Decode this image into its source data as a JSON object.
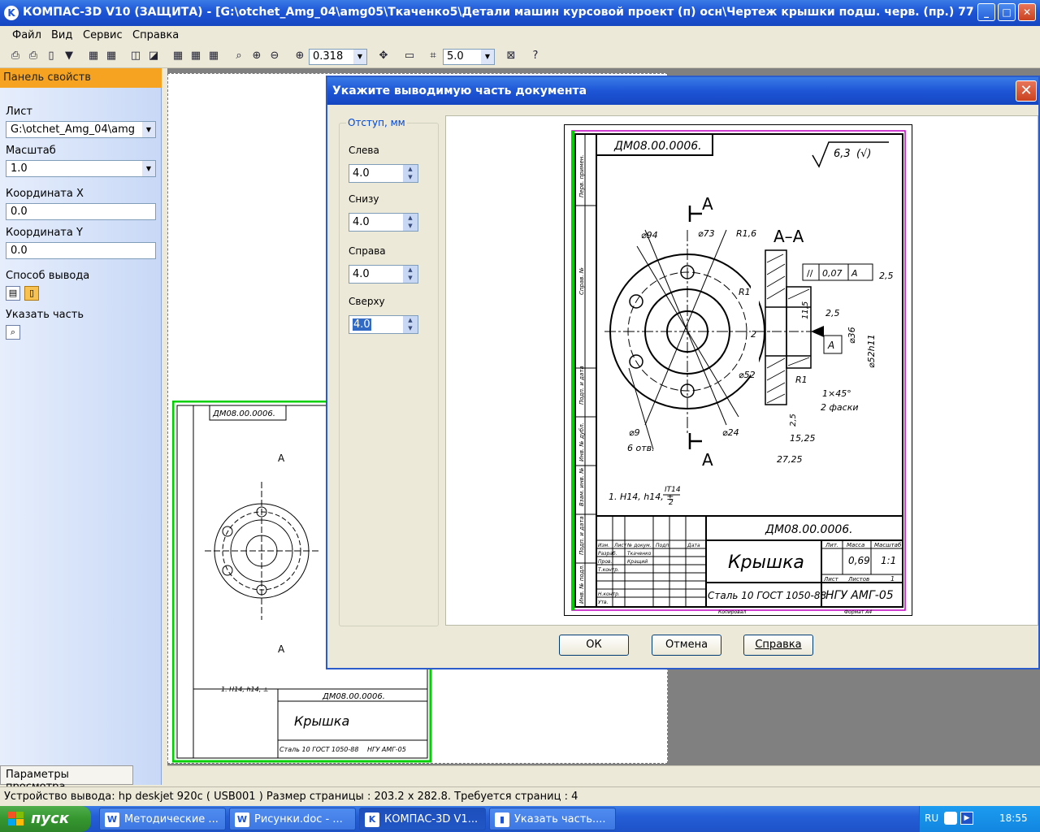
{
  "window": {
    "title": "КОМПАС-3D V10 (ЗАЩИТА) - [G:\\otchet_Amg_04\\amg05\\Ткаченко5\\Детали машин курсовой проект (п) осн\\Чертеж крышки подш. черв. (пр.) 777 ...",
    "minimize": "_",
    "maximize": "□",
    "close": "✕"
  },
  "menu": [
    "Файл",
    "Вид",
    "Сервис",
    "Справка"
  ],
  "toolbar": {
    "zoom": "0.318",
    "step": "5.0"
  },
  "panel": {
    "title": "Панель свойств",
    "sheet_label": "Лист",
    "sheet_value": "G:\\otchet_Amg_04\\amg",
    "scale_label": "Масштаб",
    "scale_value": "1.0",
    "x_label": "Координата X",
    "x_value": "0.0",
    "y_label": "Координата Y",
    "y_value": "0.0",
    "output_label": "Способ вывода",
    "part_label": "Указать часть",
    "bottom_tab": "Параметры просмотра"
  },
  "status": "Устройство вывода: hp deskjet 920c ( USB001 )  Размер страницы : 203.2 x 282.8.  Требуется страниц : 4",
  "taskbar": {
    "start": "пуск",
    "tasks": [
      "Методические ...",
      "Рисунки.doc - ...",
      "КОМПАС-3D V1...",
      "Указать часть...."
    ],
    "lang": "RU",
    "time": "18:55"
  },
  "dialog": {
    "title": "Укажите выводимую часть документа",
    "group": "Отступ, мм",
    "left_label": "Слева",
    "left_value": "4.0",
    "bottom_label": "Снизу",
    "bottom_value": "4.0",
    "right_label": "Справа",
    "right_value": "4.0",
    "top_label": "Сверху",
    "top_value": "4.0",
    "ok": "ОК",
    "cancel": "Отмена",
    "help": "Справка"
  },
  "drawing": {
    "code_rotated": "ДМ08.00.0006.",
    "code": "ДМ08.00.0006.",
    "roughness": "6,3",
    "section": "А–А",
    "letter": "А",
    "dims": {
      "d94": "⌀94",
      "d73": "⌀73",
      "r16": "R1,6",
      "r1": "R1",
      "d52": "⌀52",
      "d24": "⌀24",
      "holes": "⌀9",
      "holes_count": "6 отв.",
      "two": "2",
      "d36": "⌀36",
      "d52h11": "⌀52h11",
      "t007": "0,07",
      "r25": "2,5",
      "d115": "11,5",
      "chamfer": "1×45°",
      "chamfer2": "2 фаски",
      "l25": "2,5",
      "l1525": "15,25",
      "l2725": "27,25"
    },
    "note": "1. H14, h14, ±",
    "note_frac_top": "IT14",
    "note_frac_bottom": "2",
    "name": "Крышка",
    "material": "Сталь 10  ГОСТ 1050-88",
    "org": "НГУ АМГ-05",
    "mass": "0,69",
    "scale": "1:1",
    "copied": "Копировал",
    "format": "Формат А4",
    "col_lit": "Лит.",
    "col_mass": "Масса",
    "col_scale": "Масштаб",
    "sheet": "Лист",
    "sheets": "Листов",
    "sheets_n": "1",
    "rows": [
      "Изм.",
      "Лист",
      "№ докум.",
      "Подп.",
      "Дата",
      "Разраб.",
      "Ткаченко",
      "Пров.",
      "Кращий",
      "Т.контр.",
      "Н.контр.",
      "Утв."
    ],
    "side": [
      "Перв. примен.",
      "Справ. №",
      "Подп. и дата",
      "Инв. № дубл.",
      "Взам. инв. №",
      "Подп. и дата",
      "Инв. № подл."
    ]
  }
}
